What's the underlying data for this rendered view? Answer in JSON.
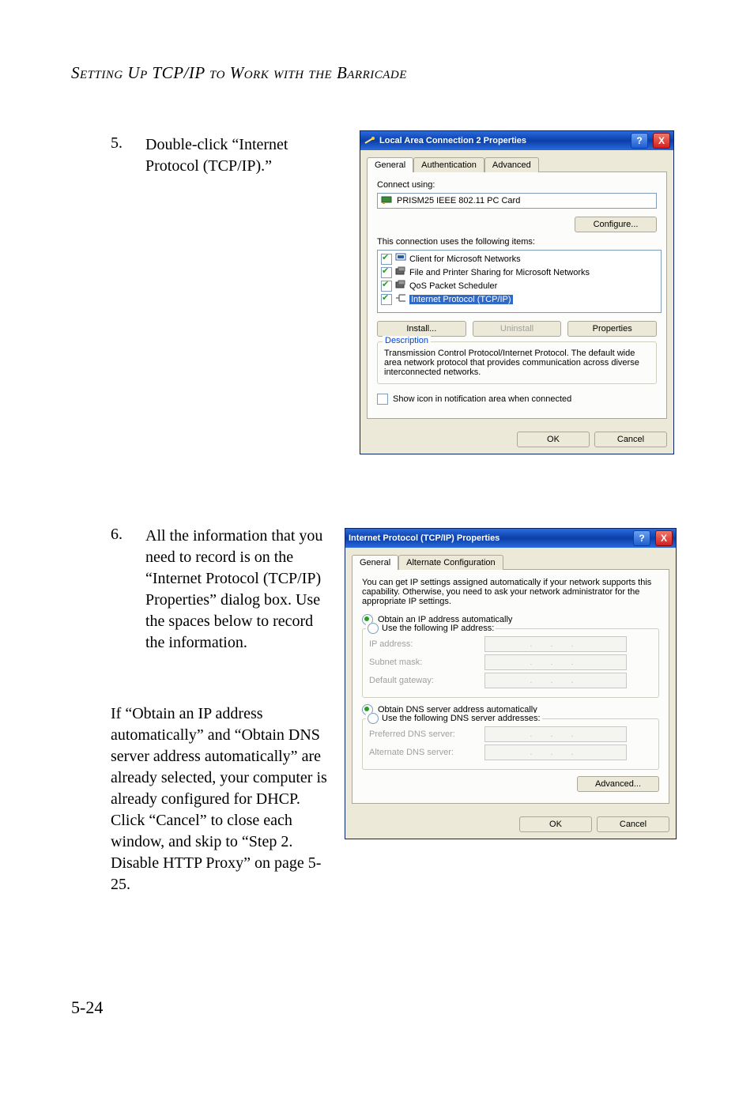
{
  "header": "Setting Up TCP/IP to Work with the Barricade",
  "steps": {
    "five": {
      "num": "5.",
      "text": "Double-click “Internet Protocol (TCP/IP).”"
    },
    "six": {
      "num": "6.",
      "text": "All the information that you need to record is on the “Internet Protocol (TCP/IP) Properties” dialog box. Use the spaces below to record the information."
    }
  },
  "paragraph": "If “Obtain an IP address automatically” and “Obtain DNS server address automatically” are already selected, your computer is already configured for DHCP. Click “Cancel” to close each window, and skip to “Step 2. Disable HTTP Proxy” on page 5-25.",
  "page_number": "5-24",
  "dialog1": {
    "title": "Local Area Connection 2 Properties",
    "tabs": [
      "General",
      "Authentication",
      "Advanced"
    ],
    "connect_label": "Connect using:",
    "adapter": "PRISM25 IEEE 802.11 PC Card",
    "configure_btn": "Configure...",
    "items_label": "This connection uses the following items:",
    "items": [
      "Client for Microsoft Networks",
      "File and Printer Sharing for Microsoft Networks",
      "QoS Packet Scheduler",
      "Internet Protocol (TCP/IP)"
    ],
    "install_btn": "Install...",
    "uninstall_btn": "Uninstall",
    "properties_btn": "Properties",
    "desc_legend": "Description",
    "desc_text": "Transmission Control Protocol/Internet Protocol. The default wide area network protocol that provides communication across diverse interconnected networks.",
    "show_icon": "Show icon in notification area when connected",
    "ok": "OK",
    "cancel": "Cancel",
    "help": "?",
    "close": "X"
  },
  "dialog2": {
    "title": "Internet Protocol (TCP/IP) Properties",
    "tabs": [
      "General",
      "Alternate Configuration"
    ],
    "intro": "You can get IP settings assigned automatically if your network supports this capability. Otherwise, you need to ask your network administrator for the appropriate IP settings.",
    "obtain_ip": "Obtain an IP address automatically",
    "use_ip": "Use the following IP address:",
    "ip_address": "IP address:",
    "subnet": "Subnet mask:",
    "gateway": "Default gateway:",
    "obtain_dns": "Obtain DNS server address automatically",
    "use_dns": "Use the following DNS server addresses:",
    "pref_dns": "Preferred DNS server:",
    "alt_dns": "Alternate DNS server:",
    "advanced": "Advanced...",
    "ok": "OK",
    "cancel": "Cancel",
    "help": "?",
    "close": "X",
    "dots": ". . ."
  }
}
